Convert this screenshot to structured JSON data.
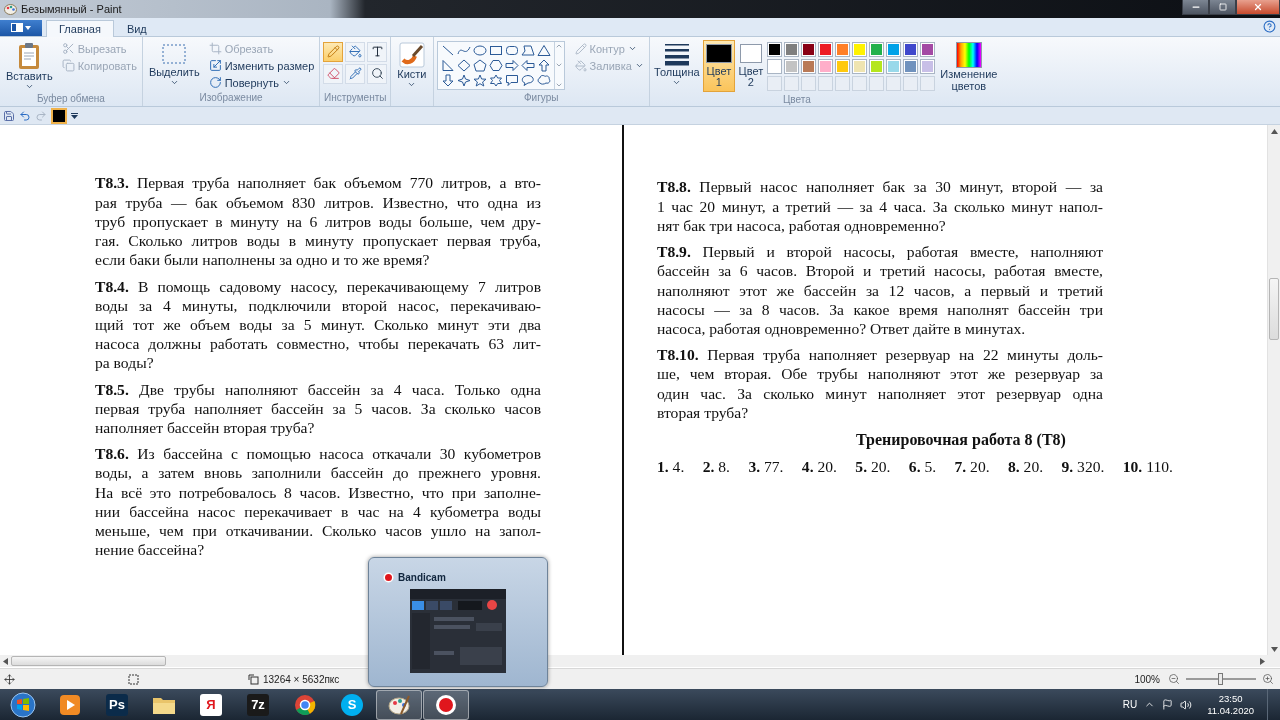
{
  "window": {
    "title": "Безымянный - Paint"
  },
  "tabs": [
    {
      "label": "Главная",
      "selected": true
    },
    {
      "label": "Вид",
      "selected": false
    }
  ],
  "ribbon": {
    "clipboard": {
      "title": "Буфер обмена",
      "paste": {
        "label": "Вставить",
        "disabled": false
      },
      "small": [
        {
          "kind": "cut",
          "label": "Вырезать",
          "disabled": true
        },
        {
          "kind": "copy",
          "label": "Копировать",
          "disabled": true
        }
      ]
    },
    "image": {
      "title": "Изображение",
      "select": {
        "label": "Выделить",
        "disabled": false
      },
      "small": [
        {
          "kind": "crop",
          "label": "Обрезать",
          "disabled": true
        },
        {
          "kind": "resize",
          "label": "Изменить размер",
          "disabled": false
        },
        {
          "kind": "rotate",
          "label": "Повернуть",
          "disabled": false
        }
      ]
    },
    "tools": {
      "title": "Инструменты",
      "items": [
        {
          "kind": "pencil",
          "selected": true
        },
        {
          "kind": "fill",
          "selected": false
        },
        {
          "kind": "text",
          "selected": false
        },
        {
          "kind": "eraser",
          "selected": false
        },
        {
          "kind": "picker",
          "selected": false
        },
        {
          "kind": "magnifier",
          "selected": false
        }
      ]
    },
    "brushes": {
      "label": "Кисти"
    },
    "shapes": {
      "title": "Фигуры",
      "options": [
        {
          "kind": "outline",
          "label": "Контур",
          "disabled": true
        },
        {
          "kind": "fill",
          "label": "Заливка",
          "disabled": true
        }
      ]
    },
    "size": {
      "label": "Толщина"
    },
    "color_slots": [
      {
        "label": "Цвет 1",
        "selected": true,
        "color": "#000000"
      },
      {
        "label": "Цвет 2",
        "selected": false,
        "color": "#ffffff"
      }
    ],
    "palette": {
      "title": "Цвета",
      "colors": [
        {
          "color": "#000000"
        },
        {
          "color": "#7f7f7f"
        },
        {
          "color": "#880015"
        },
        {
          "color": "#ed1c24"
        },
        {
          "color": "#ff7f27"
        },
        {
          "color": "#fff200"
        },
        {
          "color": "#22b14c"
        },
        {
          "color": "#00a2e8"
        },
        {
          "color": "#3f48cc"
        },
        {
          "color": "#a349a4"
        },
        {
          "color": "#ffffff"
        },
        {
          "color": "#c3c3c3"
        },
        {
          "color": "#b97a57"
        },
        {
          "color": "#ffaec9"
        },
        {
          "color": "#ffc90e"
        },
        {
          "color": "#efe4b0"
        },
        {
          "color": "#b5e61d"
        },
        {
          "color": "#99d9ea"
        },
        {
          "color": "#7092be"
        },
        {
          "color": "#c8bfe7"
        }
      ]
    },
    "edit_colors": {
      "label": "Изменение цветов"
    }
  },
  "document": {
    "left": [
      {
        "lines": [
          "**T8.3.** Первая труба наполняет бак объемом 770 литров, а вто-",
          "рая труба — бак объемом 830 литров. Известно, что одна из",
          "труб пропускает в минуту на 6 литров воды больше, чем дру-",
          "гая. Сколько литров воды в минуту пропускает первая труба,",
          "если баки были наполнены за одно и то же время?"
        ]
      },
      {
        "lines": [
          "**T8.4.** В помощь садовому насосу, перекачивающему 7 литров",
          "воды за 4 минуты, подключили второй насос, перекачиваю-",
          "щий тот же объем воды за 5 минут. Сколько минут эти два",
          "насоса должны работать совместно, чтобы перекачать 63 лит-",
          "ра воды?"
        ]
      },
      {
        "lines": [
          "**T8.5.** Две трубы наполняют бассейн за 4 часа. Только одна",
          "первая труба наполняет бассейн за 5 часов. За сколько часов",
          "наполняет бассейн вторая труба?"
        ]
      },
      {
        "lines": [
          "**T8.6.** Из бассейна с помощью насоса откачали 30 кубометров",
          "воды, а затем вновь заполнили бассейн до прежнего уровня.",
          "На всё это потребовалось 8 часов. Известно, что при заполне-",
          "нии бассейна насос перекачивает в час на 4 кубометра воды",
          "меньше, чем при откачивании. Сколько часов ушло на запол-",
          "нение бассейна?"
        ]
      }
    ],
    "right": [
      {
        "lines": [
          "**T8.8.** Первый насос наполняет бак за 30 минут, второй — за",
          "1 час 20 минут, а третий — за 4 часа. За сколько минут напол-",
          "нят бак три насоса, работая одновременно?"
        ]
      },
      {
        "lines": [
          "**T8.9.** Первый и второй насосы, работая вместе, наполняют",
          "бассейн за 6 часов. Второй и третий насосы, работая вместе,",
          "наполняют этот же бассейн за 12 часов, а первый и третий",
          "насосы — за 8 часов. За какое время наполнят бассейн три",
          "насоса, работая одновременно? Ответ дайте в минутах."
        ]
      },
      {
        "lines": [
          "**T8.10.** Первая труба наполняет резервуар на 22 минуты доль-",
          "ше, чем вторая. Обе трубы наполняют этот же резервуар за",
          "один час. За сколько минут наполняет этот резервуар одна",
          "вторая труба?"
        ]
      }
    ],
    "heading": "Тренировочная работа 8 (Т8)",
    "answers": [
      "**1.** 4.",
      "**2.** 8.",
      "**3.** 77.",
      "**4.** 20.",
      "**5.** 20.",
      "**6.** 5.",
      "**7.** 20.",
      "**8.** 20.",
      "**9.** 320.",
      "**10.** 110."
    ]
  },
  "thumbnail": {
    "title": "Bandicam"
  },
  "status": {
    "canvas_size": "13264 × 5632пкс",
    "zoom": {
      "reading": "100%",
      "level": 0.5
    }
  },
  "taskbar": {
    "items": [
      {
        "kind": "start",
        "selected": false
      },
      {
        "kind": "media",
        "selected": false
      },
      {
        "kind": "text",
        "label": "Ps",
        "color": "#0b2b4a",
        "selected": false
      },
      {
        "kind": "folder",
        "selected": false
      },
      {
        "kind": "text",
        "label": "Я",
        "color": "#ffffff",
        "selected": false
      },
      {
        "kind": "text",
        "label": "7z",
        "color": "#1a1a1a",
        "selected": false
      },
      {
        "kind": "chrome",
        "selected": false
      },
      {
        "kind": "text",
        "label": "S",
        "color": "#00aff0",
        "selected": false
      },
      {
        "kind": "paint",
        "selected": true
      },
      {
        "kind": "record",
        "selected": true
      }
    ],
    "language": "RU",
    "time": "23:50",
    "date": "11.04.2020"
  }
}
